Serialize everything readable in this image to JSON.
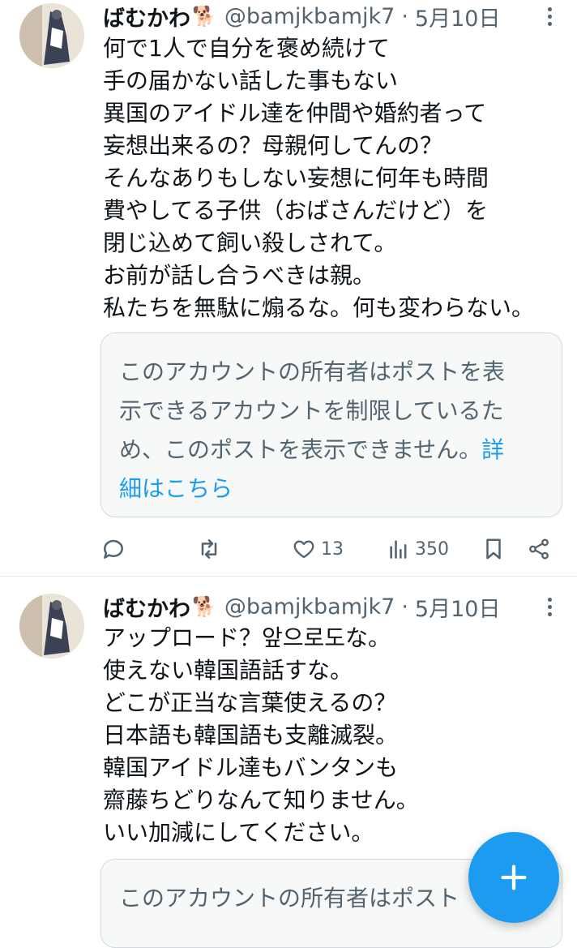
{
  "colors": {
    "accent": "#1d9bf0",
    "text": "#0f1419",
    "muted": "#536471",
    "border": "#cfd9de"
  },
  "tweets": [
    {
      "author": {
        "name": "ばむかわ",
        "badge_emoji": "🐕",
        "handle": "@bamjkbamjk7",
        "separator": "·",
        "date": "5月10日"
      },
      "lines": [
        "何で1人で自分を褒め続けて",
        "手の届かない話した事もない",
        "異国のアイドル達を仲間や婚約者って",
        "妄想出来るの？母親何してんの？",
        "そんなありもしない妄想に何年も時間",
        "費やしてる子供（おばさんだけど）を",
        "閉じ込めて飼い殺しされて。",
        "お前が話し合うべきは親。",
        "私たちを無駄に煽るな。何も変わらない。"
      ],
      "notice": {
        "lines": [
          "このアカウントの所有者はポストを表",
          "示できるアカウントを制限しているた",
          "め、このポストを表示できません。"
        ],
        "link_part1": "詳",
        "link_part2": "細はこちら"
      },
      "actions": {
        "reply_icon": "reply-icon",
        "repost_icon": "repost-icon",
        "like_count": "13",
        "views_count": "350",
        "bookmark_icon": "bookmark-icon",
        "share_icon": "share-icon"
      }
    },
    {
      "author": {
        "name": "ばむかわ",
        "badge_emoji": "🐕",
        "handle": "@bamjkbamjk7",
        "separator": "·",
        "date": "5月10日"
      },
      "lines": [
        "アップロード？앞으로도な。",
        "使えない韓国語話すな。",
        "どこが正当な言葉使えるの？",
        "日本語も韓国語も支離滅裂。",
        "韓国アイドル達もバンタンも",
        "齋藤ちどりなんて知りません。",
        "いい加減にしてください。"
      ],
      "notice": {
        "lines": [
          "このアカウントの所有者はポスト"
        ]
      }
    }
  ],
  "fab": {
    "icon": "plus-icon"
  }
}
